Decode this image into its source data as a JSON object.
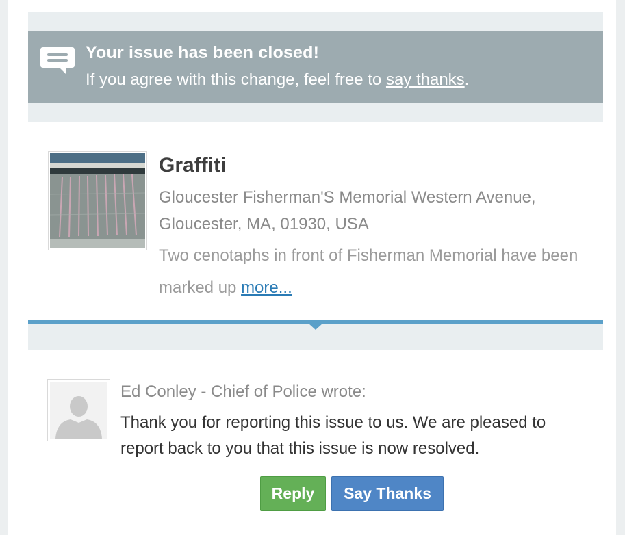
{
  "notice": {
    "title": "Your issue has been closed!",
    "subtitle_prefix": "If you agree with this change, feel free to ",
    "subtitle_link": "say thanks",
    "subtitle_suffix": ".",
    "icon": "speech-bubble-icon"
  },
  "issue": {
    "title": "Graffiti",
    "address": "Gloucester Fisherman'S Memorial Western Avenue, Gloucester, MA, 01930, USA",
    "description": "Two cenotaphs in front of Fisherman Memorial have been marked up",
    "more_link": "more..."
  },
  "comment": {
    "author": "Ed Conley - Chief of Police wrote:",
    "body": "Thank you for reporting this issue to us. We are pleased to report back to you that this issue is now resolved.",
    "avatar_icon": "default-person-icon"
  },
  "actions": {
    "reply_label": "Reply",
    "thanks_label": "Say Thanks"
  },
  "colors": {
    "notice_bg": "#9dabb0",
    "accent_blue": "#5ba0c9",
    "reply_green": "#64b057",
    "thanks_blue": "#4f86c6",
    "link_blue": "#2a7bb5"
  }
}
